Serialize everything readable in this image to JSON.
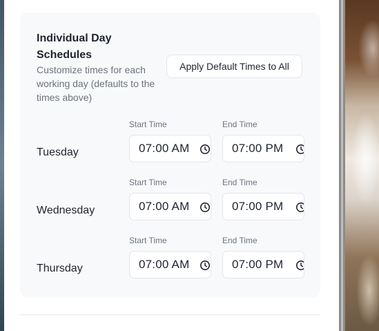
{
  "section": {
    "title": "Individual Day Schedules",
    "description": "Customize times for each working day (defaults to the times above)",
    "apply_button": "Apply Default Times to All"
  },
  "labels": {
    "start": "Start Time",
    "end": "End Time"
  },
  "days": [
    {
      "name": "Tuesday",
      "start": "07:00 AM",
      "end": "07:00 PM"
    },
    {
      "name": "Wednesday",
      "start": "07:00 AM",
      "end": "07:00 PM"
    },
    {
      "name": "Thursday",
      "start": "07:00 AM",
      "end": "07:00 PM"
    }
  ],
  "icons": {
    "time_input": "clock-icon"
  },
  "colors": {
    "card_bg": "#f8f9fb",
    "text_primary": "#1f2430",
    "text_muted": "#6b7280",
    "border": "#e3e5ea"
  }
}
